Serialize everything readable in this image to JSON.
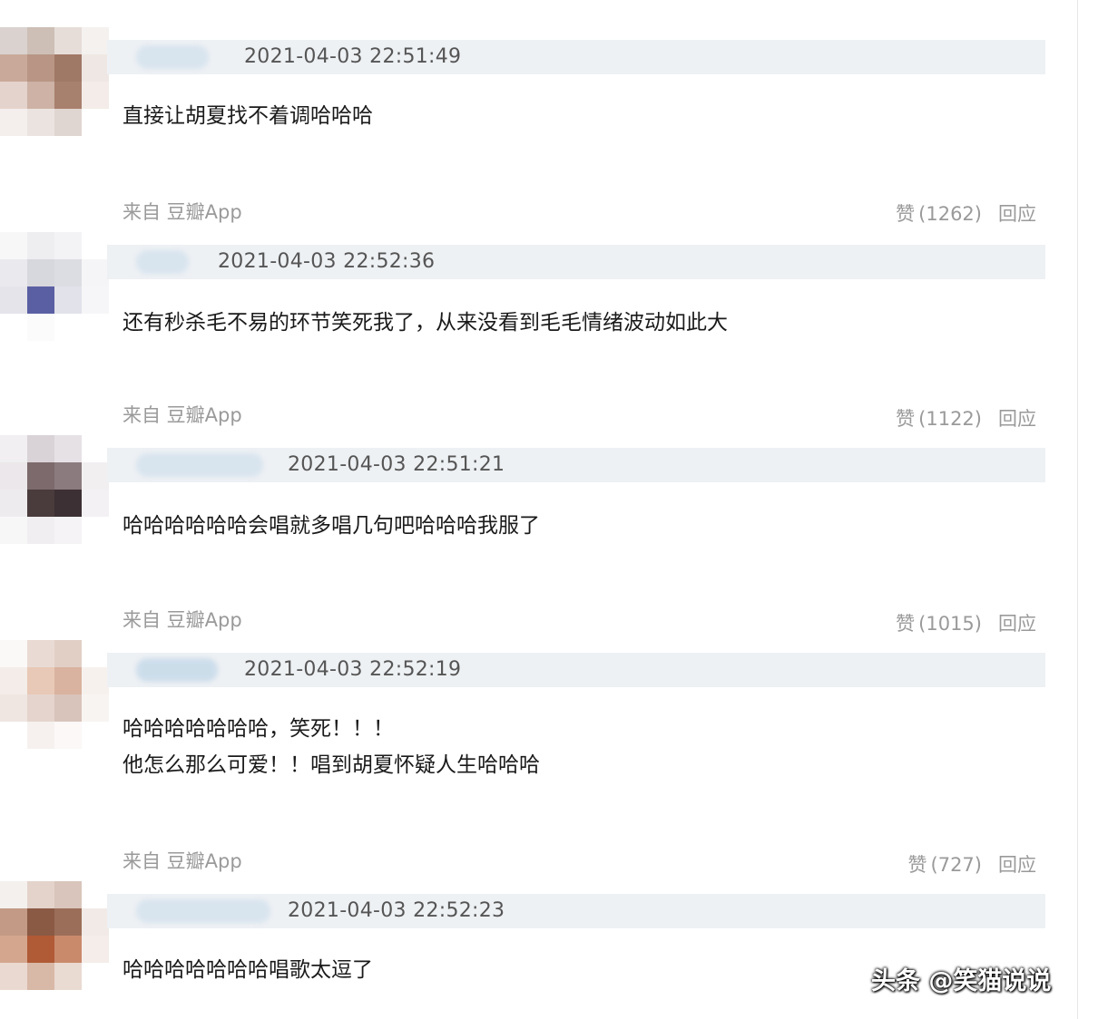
{
  "comments": [
    {
      "timestamp": "2021-04-03 22:51:49",
      "lines": [
        "直接让胡夏找不着调哈哈哈"
      ],
      "source": "来自 豆瓣App",
      "like_label": "赞",
      "like_count": "1262",
      "reply_label": "回应"
    },
    {
      "timestamp": "2021-04-03 22:52:36",
      "lines": [
        "还有秒杀毛不易的环节笑死我了，从来没看到毛毛情绪波动如此大"
      ],
      "source": "来自 豆瓣App",
      "like_label": "赞",
      "like_count": "1122",
      "reply_label": "回应"
    },
    {
      "timestamp": "2021-04-03 22:51:21",
      "lines": [
        "哈哈哈哈哈哈会唱就多唱几句吧哈哈哈我服了"
      ],
      "source": "来自 豆瓣App",
      "like_label": "赞",
      "like_count": "1015",
      "reply_label": "回应"
    },
    {
      "timestamp": "2021-04-03 22:52:19",
      "lines": [
        "哈哈哈哈哈哈哈，笑死！！！",
        "他怎么那么可爱！！唱到胡夏怀疑人生哈哈哈"
      ],
      "source": "来自 豆瓣App",
      "like_label": "赞",
      "like_count": "727",
      "reply_label": "回应"
    },
    {
      "timestamp": "2021-04-03 22:52:23",
      "lines": [
        "哈哈哈哈哈哈哈唱歌太逗了"
      ]
    }
  ],
  "watermark": "头条 @笑猫说说"
}
